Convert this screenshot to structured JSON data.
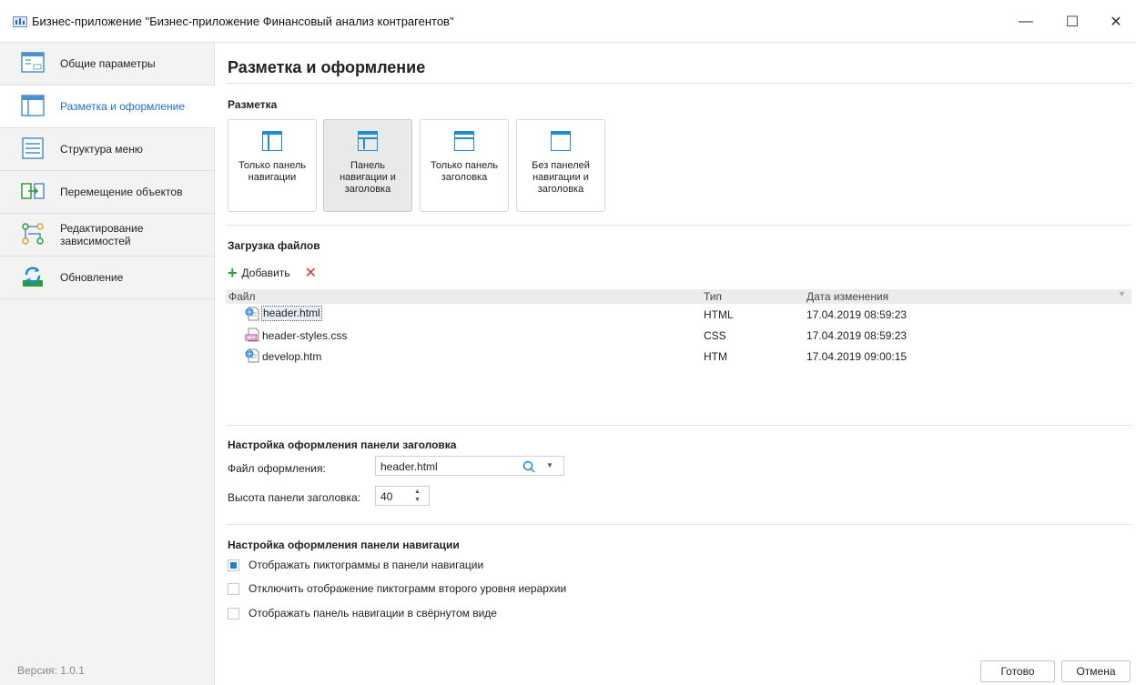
{
  "window": {
    "title": "Бизнес-приложение \"Бизнес-приложение Финансовый анализ контрагентов\"",
    "minimize": "—",
    "maximize": "☐",
    "close": "✕"
  },
  "sidebar": {
    "items": [
      {
        "label": "Общие параметры",
        "icon": "general-settings-icon"
      },
      {
        "label": "Разметка и оформление",
        "icon": "layout-icon"
      },
      {
        "label": "Структура меню",
        "icon": "menu-structure-icon"
      },
      {
        "label": "Перемещение объектов",
        "icon": "move-objects-icon"
      },
      {
        "label": "Редактирование зависимостей",
        "icon": "dependencies-icon"
      },
      {
        "label": "Обновление",
        "icon": "update-icon"
      }
    ],
    "active_index": 1,
    "version": "Версия: 1.0.1"
  },
  "main": {
    "title": "Разметка и оформление",
    "layout_section": {
      "title": "Разметка",
      "options": [
        {
          "label": "Только панель навигации",
          "selected": false
        },
        {
          "label": "Панель навигации и заголовка",
          "selected": true
        },
        {
          "label": "Только панель заголовка",
          "selected": false
        },
        {
          "label": "Без панелей навигации и заголовка",
          "selected": false
        }
      ]
    },
    "files_section": {
      "title": "Загрузка файлов",
      "add_label": "Добавить",
      "delete_icon": "✕",
      "columns": {
        "file": "Файл",
        "type": "Тип",
        "date": "Дата изменения"
      },
      "rows": [
        {
          "name": "header.html",
          "type": "HTML",
          "date": "17.04.2019 08:59:23",
          "icon": "html-file-icon"
        },
        {
          "name": "header-styles.css",
          "type": "CSS",
          "date": "17.04.2019 08:59:23",
          "icon": "css-file-icon"
        },
        {
          "name": "develop.htm",
          "type": "HTM",
          "date": "17.04.2019 09:00:15",
          "icon": "html-file-icon"
        }
      ]
    },
    "header_settings": {
      "title": "Настройка оформления панели заголовка",
      "file_label": "Файл оформления:",
      "file_value": "header.html",
      "height_label": "Высота панели заголовка:",
      "height_value": "40"
    },
    "nav_settings": {
      "title": "Настройка оформления панели навигации",
      "checkboxes": [
        {
          "label": "Отображать пиктограммы в панели навигации",
          "checked": true
        },
        {
          "label": "Отключить отображение пиктограмм второго уровня иерархии",
          "checked": false
        },
        {
          "label": "Отображать панель навигации в свёрнутом виде",
          "checked": false
        }
      ]
    },
    "buttons": {
      "done": "Готово",
      "cancel": "Отмена"
    }
  },
  "colors": {
    "accent": "#1f6fc5",
    "icon_blue": "#1f8bd6",
    "add_green": "#2a9d3a",
    "delete_red": "#e0302a"
  }
}
